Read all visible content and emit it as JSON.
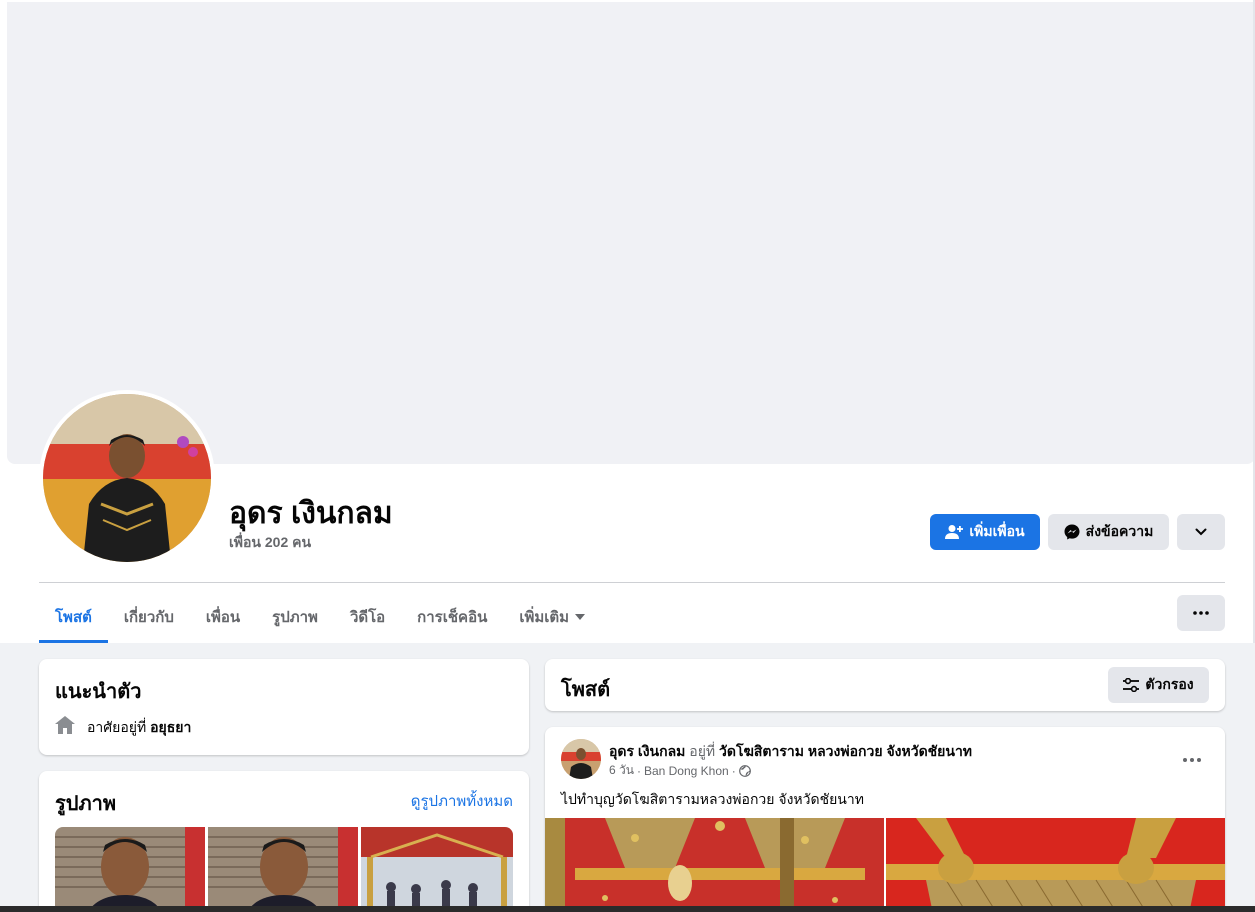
{
  "profile": {
    "name": "อุดร เงินกลม",
    "friends_text": "เพื่อน 202 คน"
  },
  "actions": {
    "add_friend": "เพิ่มเพื่อน",
    "message": "ส่งข้อความ"
  },
  "tabs": [
    {
      "label": "โพสต์",
      "active": true
    },
    {
      "label": "เกี่ยวกับ"
    },
    {
      "label": "เพื่อน"
    },
    {
      "label": "รูปภาพ"
    },
    {
      "label": "วิดีโอ"
    },
    {
      "label": "การเช็คอิน"
    },
    {
      "label": "เพิ่มเติม"
    }
  ],
  "intro": {
    "title": "แนะนำตัว",
    "lives_prefix": "อาศัยอยู่ที่",
    "lives_place": "อยุธยา"
  },
  "photos": {
    "title": "รูปภาพ",
    "see_all": "ดูรูปภาพทั้งหมด"
  },
  "posts_header": {
    "title": "โพสต์",
    "filter": "ตัวกรอง"
  },
  "post": {
    "author": "อุดร เงินกลม",
    "at_word": "อยู่ที่",
    "place": "วัดโฆสิตาราม หลวงพ่อกวย จังหวัดชัยนาท",
    "time": "6 วัน",
    "location": "Ban Dong Khon",
    "text": "ไปทำบุญวัดโฆสิตารามหลวงพ่อกวย จังหวัดชัยนาท"
  },
  "colors": {
    "accent": "#1b74e4",
    "page_bg": "#f0f2f5"
  }
}
